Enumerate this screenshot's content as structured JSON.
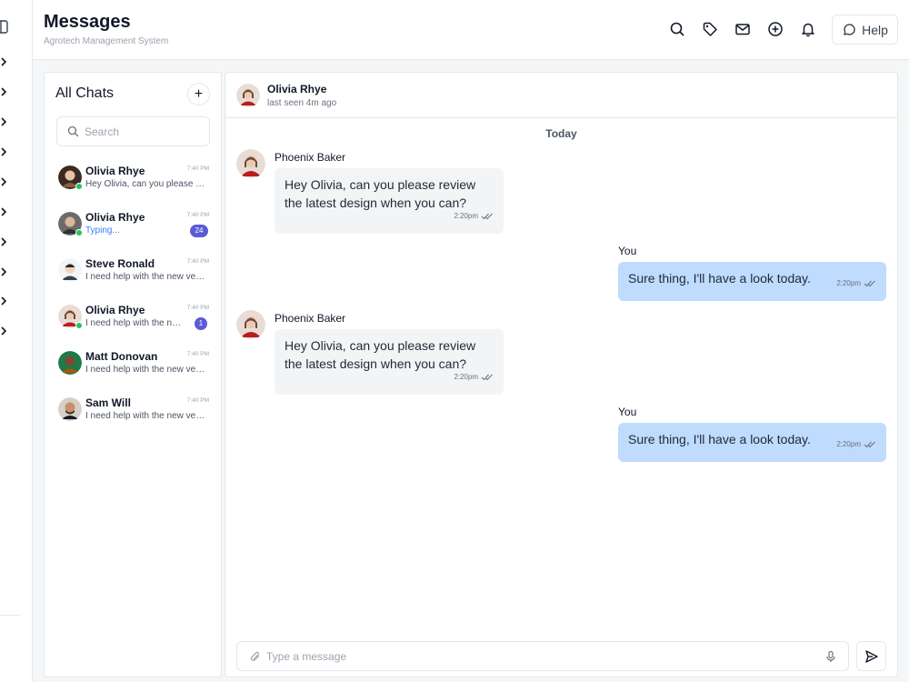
{
  "header": {
    "title": "Messages",
    "subtitle": "Agrotech Management System",
    "icons": [
      "search-icon",
      "tag-icon",
      "mail-icon",
      "add-circle-icon",
      "bell-icon"
    ],
    "help_label": "Help"
  },
  "sidebar": {
    "items": [
      "chevron-right-icon",
      "chevron-right-icon",
      "chevron-right-icon",
      "chevron-right-icon",
      "chevron-right-icon",
      "chevron-right-icon",
      "chevron-right-icon",
      "chevron-right-icon",
      "chevron-right-icon",
      "chevron-right-icon"
    ]
  },
  "chat_list": {
    "title": "All Chats",
    "search_placeholder": "Search",
    "chats": [
      {
        "name": "Olivia Rhye",
        "preview": "Hey Olivia, can you please review the latest design",
        "time": "7:40 PM",
        "online": true,
        "badge": ""
      },
      {
        "name": "Olivia Rhye",
        "preview": "Typing...",
        "time": "7:40 PM",
        "online": true,
        "badge": "24"
      },
      {
        "name": "Steve Ronald",
        "preview": "I need help with the new version",
        "time": "7:40 PM",
        "online": false,
        "badge": ""
      },
      {
        "name": "Olivia Rhye",
        "preview": "I need help with the new version",
        "time": "7:40 PM",
        "online": true,
        "badge": "1"
      },
      {
        "name": "Matt Donovan",
        "preview": "I need help with the new version",
        "time": "7:40 PM",
        "online": false,
        "badge": ""
      },
      {
        "name": "Sam Will",
        "preview": "I need help with the new version",
        "time": "7:40 PM",
        "online": false,
        "badge": ""
      }
    ]
  },
  "conversation": {
    "contact_name": "Olivia Rhye",
    "contact_status": "last seen 4m ago",
    "day_label": "Today",
    "messages": [
      {
        "direction": "in",
        "sender": "Phoenix Baker",
        "text": "Hey Olivia, can you please review the latest design when you can?",
        "time": "2:20pm"
      },
      {
        "direction": "out",
        "sender": "You",
        "text": "Sure thing, I'll have a look today.",
        "time": "2:20pm"
      },
      {
        "direction": "in",
        "sender": "Phoenix Baker",
        "text": "Hey Olivia, can you please review the latest design when you can?",
        "time": "2:20pm"
      },
      {
        "direction": "out",
        "sender": "You",
        "text": "Sure thing, I'll have a look today.",
        "time": "2:20pm"
      }
    ],
    "composer_placeholder": "Type a message"
  },
  "colors": {
    "accent": "#5b5bd6",
    "online": "#22c55e",
    "outgoing_bubble": "#bfdbfe",
    "incoming_bubble": "#f3f4f6",
    "typing": "#3b82f6"
  }
}
